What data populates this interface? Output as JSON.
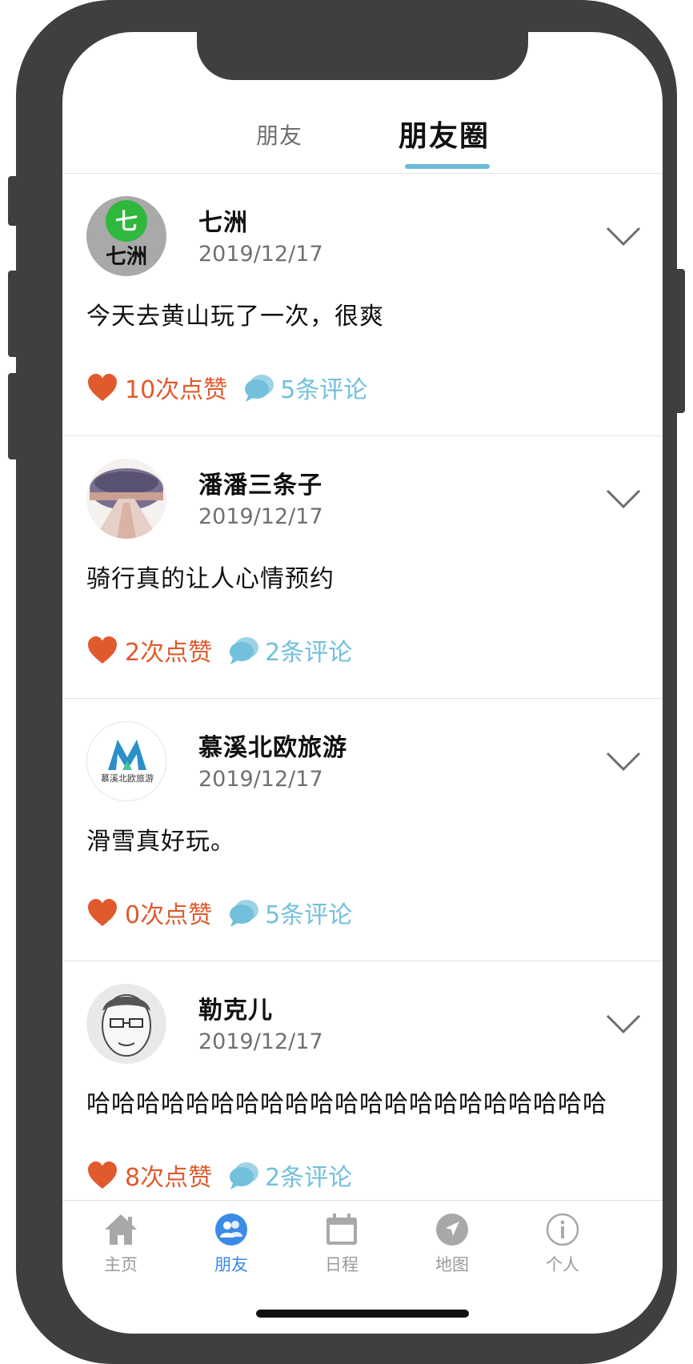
{
  "tabs": {
    "friends": "朋友",
    "moments": "朋友圈"
  },
  "posts": [
    {
      "name": "七洲",
      "date": "2019/12/17",
      "content": "今天去黄山玩了一次，很爽",
      "likes": "10次点赞",
      "comments": "5条评论",
      "avatar": {
        "top": "七",
        "bottom": "七洲"
      }
    },
    {
      "name": "潘潘三条子",
      "date": "2019/12/17",
      "content": "骑行真的让人心情预约",
      "likes": "2次点赞",
      "comments": "2条评论"
    },
    {
      "name": "慕溪北欧旅游",
      "date": "2019/12/17",
      "content": "滑雪真好玩。",
      "likes": "0次点赞",
      "comments": "5条评论",
      "avatar": {
        "caption": "慕溪北欧旅游"
      }
    },
    {
      "name": "勒克儿",
      "date": "2019/12/17",
      "content": "哈哈哈哈哈哈哈哈哈哈哈哈哈哈哈哈哈哈哈哈哈",
      "likes": "8次点赞",
      "comments": "2条评论"
    }
  ],
  "tabbar": [
    {
      "label": "主页",
      "icon": "home-icon"
    },
    {
      "label": "朋友",
      "icon": "friends-icon",
      "active": true
    },
    {
      "label": "日程",
      "icon": "calendar-icon"
    },
    {
      "label": "地图",
      "icon": "map-icon"
    },
    {
      "label": "个人",
      "icon": "info-icon"
    }
  ],
  "colors": {
    "like": "#e05a2e",
    "comment": "#72c0dc",
    "tab_active": "#3b8be6",
    "tab_underline": "#6fbad8",
    "frame": "#3f3f3f"
  }
}
